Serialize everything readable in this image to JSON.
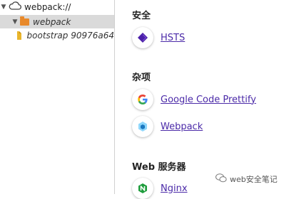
{
  "tree": {
    "root_label": "webpack://",
    "folder_label": "webpack",
    "file_label": "bootstrap 90976a64"
  },
  "sections": [
    {
      "title": "安全",
      "items": [
        {
          "label": "HSTS",
          "icon": "hsts-icon"
        }
      ]
    },
    {
      "title": "杂项",
      "items": [
        {
          "label": "Google Code Prettify",
          "icon": "google-icon"
        },
        {
          "label": "Webpack",
          "icon": "webpack-icon"
        }
      ]
    },
    {
      "title": "Web 服务器",
      "items": [
        {
          "label": "Nginx",
          "icon": "nginx-icon"
        }
      ]
    }
  ],
  "watermark": {
    "text": "web安全笔记",
    "icon": "wechat-icon"
  },
  "colors": {
    "link": "#4b2aa8",
    "selection": "#dadada",
    "folder": "#e8892b",
    "file": "#e9b52c",
    "hsts": "#4b1fa8",
    "nginx": "#1f9d3d",
    "webpack": "#5fb0e4"
  }
}
